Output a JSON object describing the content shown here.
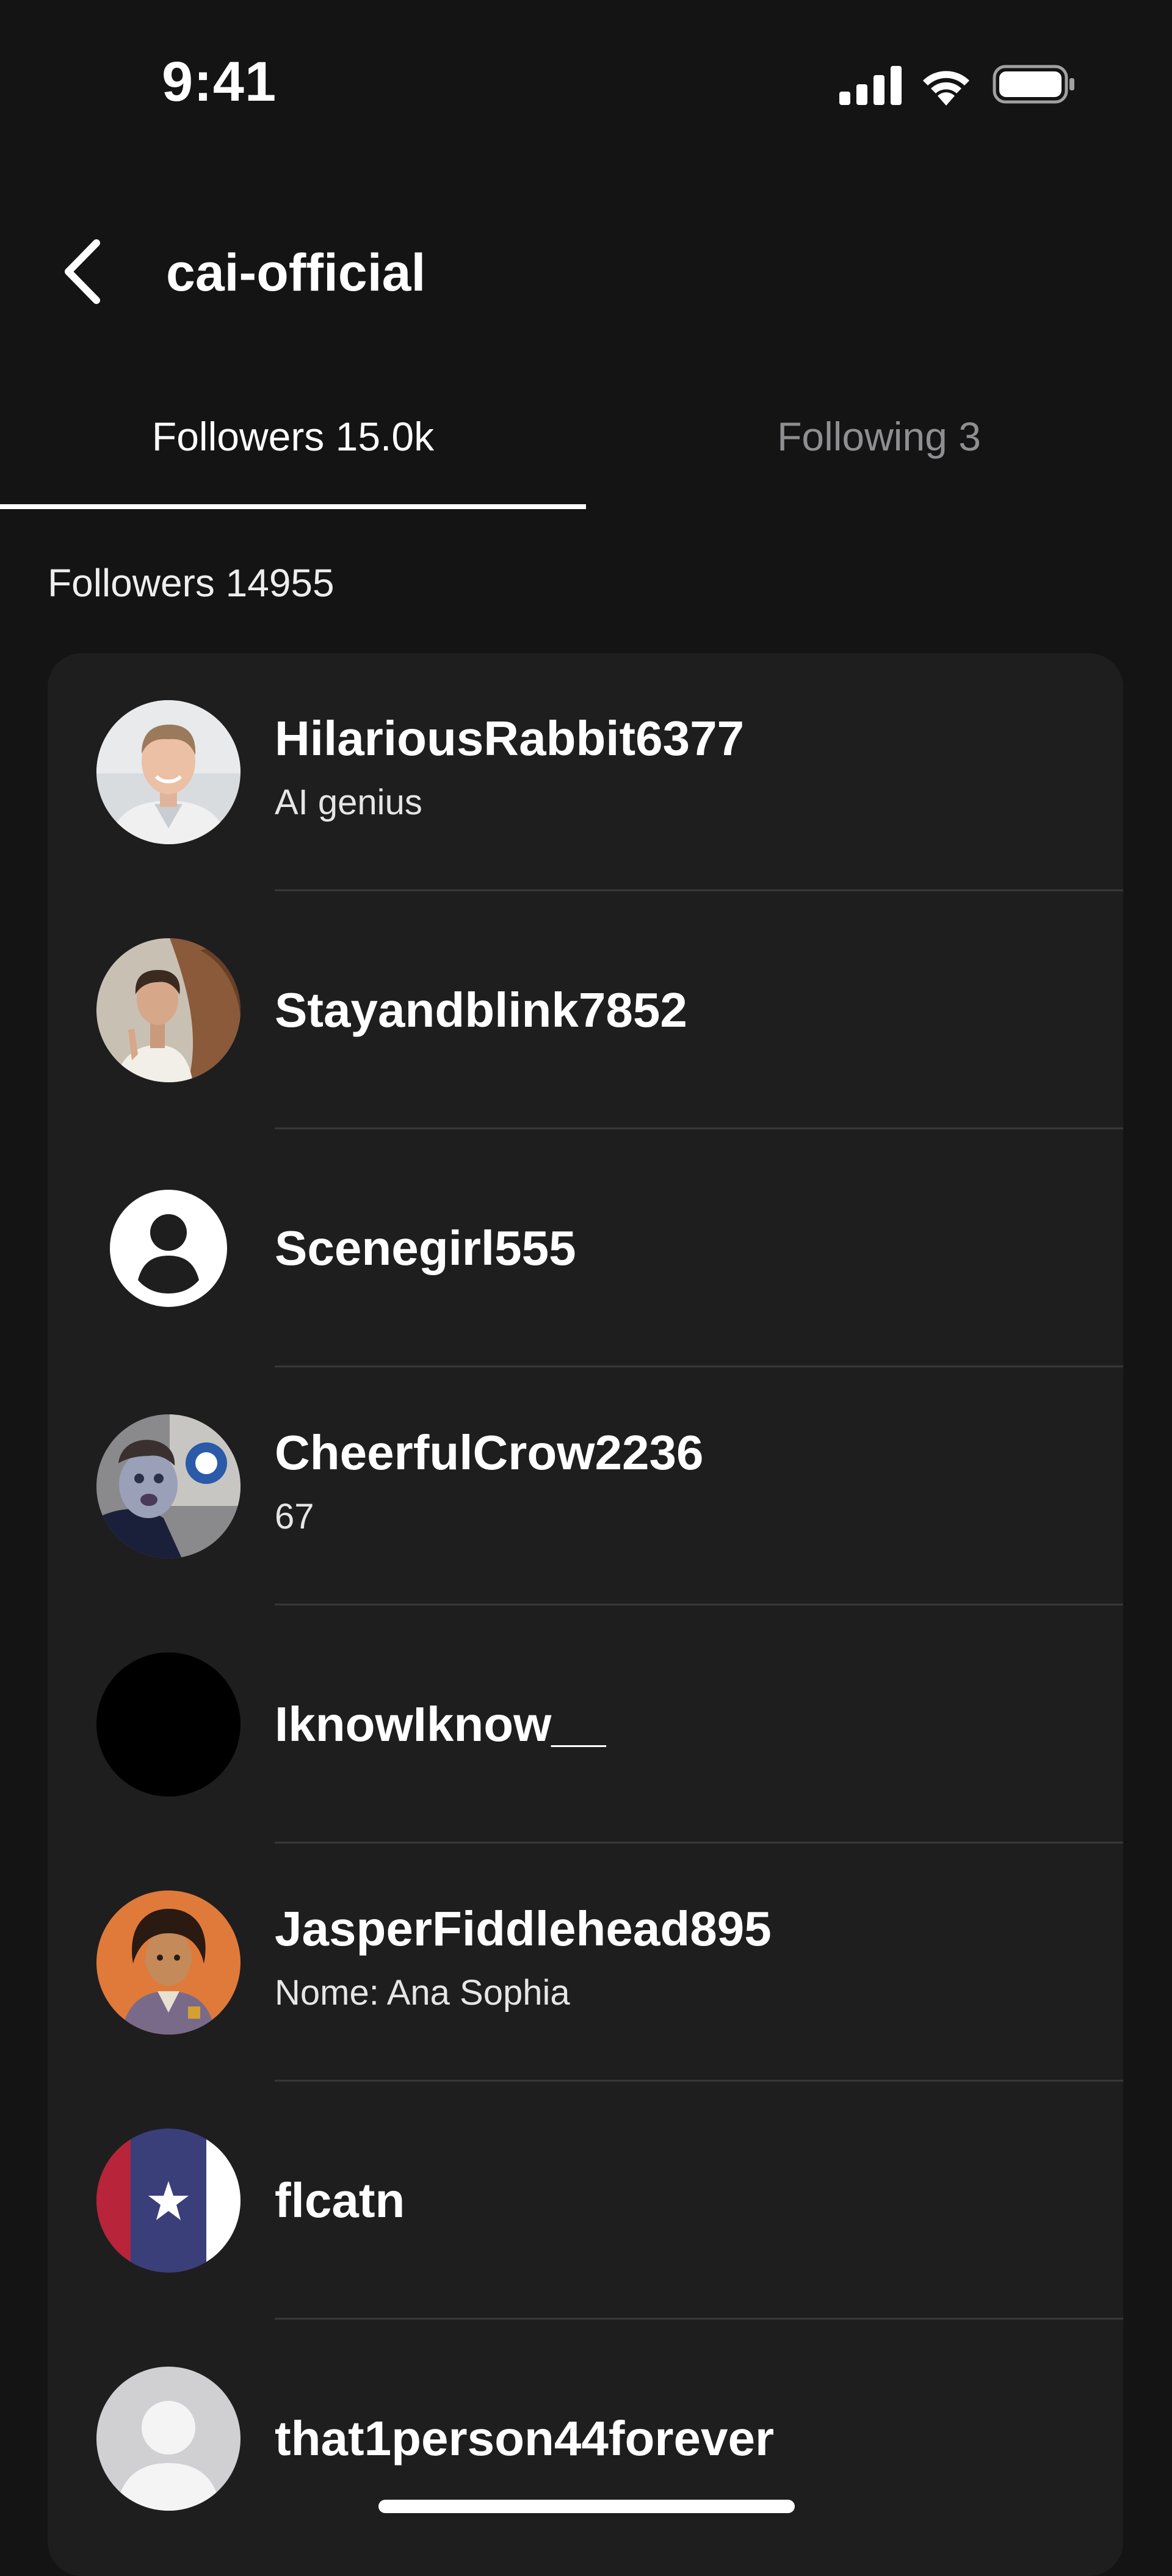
{
  "status_bar": {
    "time": "9:41",
    "icons": [
      "signal-icon",
      "wifi-icon",
      "battery-icon"
    ]
  },
  "header": {
    "back_icon": "chevron-left-icon",
    "title": "cai-official"
  },
  "tabs": [
    {
      "label": "Followers 15.0k",
      "active": true
    },
    {
      "label": "Following 3",
      "active": false
    }
  ],
  "followers_count_label": "Followers 14955",
  "followers": [
    {
      "name": "HilariousRabbit6377",
      "subtitle": "AI genius",
      "avatar": "photo-avatar"
    },
    {
      "name": "Stayandblink7852",
      "subtitle": "",
      "avatar": "photo-avatar"
    },
    {
      "name": "Scenegirl555",
      "subtitle": "",
      "avatar": "default-user-icon"
    },
    {
      "name": "CheerfulCrow2236",
      "subtitle": "67",
      "avatar": "photo-avatar"
    },
    {
      "name": "IknowIknow__",
      "subtitle": "",
      "avatar": "black-avatar"
    },
    {
      "name": "JasperFiddlehead895",
      "subtitle": "Nome: Ana Sophia",
      "avatar": "illustration-avatar"
    },
    {
      "name": "flcatn",
      "subtitle": "",
      "avatar": "flag-avatar"
    },
    {
      "name": "that1person44forever",
      "subtitle": "",
      "avatar": "default-user-icon"
    }
  ],
  "colors": {
    "background": "#141415",
    "card": "#1e1e1f",
    "divider": "#38383a",
    "inactive_tab": "#8f8f92",
    "text": "#ffffff"
  }
}
